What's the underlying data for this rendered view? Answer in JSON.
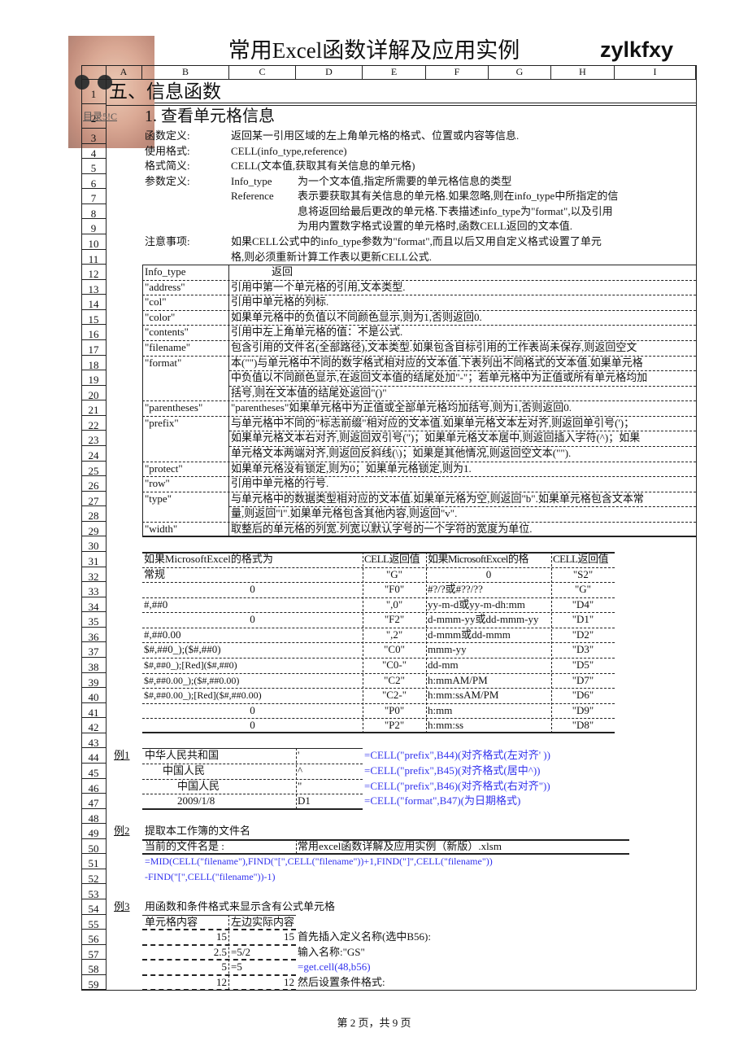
{
  "header": {
    "title": "常用Excel函数详解及应用实例",
    "author": "zylkfxy"
  },
  "columns": [
    "A",
    "B",
    "C",
    "D",
    "E",
    "F",
    "G",
    "H",
    "I"
  ],
  "row_numbers": [
    1,
    2,
    3,
    4,
    5,
    6,
    7,
    8,
    9,
    10,
    11,
    12,
    13,
    14,
    15,
    16,
    17,
    18,
    19,
    20,
    21,
    22,
    23,
    24,
    25,
    26,
    27,
    28,
    29,
    30,
    31,
    32,
    33,
    34,
    35,
    36,
    37,
    38,
    39,
    40,
    41,
    42,
    43,
    44,
    45,
    46,
    47,
    48,
    49,
    50,
    51,
    52,
    53,
    54,
    55,
    56,
    57,
    58,
    59
  ],
  "section": {
    "heading": "五、信息函数",
    "link": "目录5!C",
    "subheading": "1.  查看单元格信息"
  },
  "definition": {
    "def_label": "函数定义:",
    "def_text": "返回某一引用区域的左上角单元格的格式、位置或内容等信息.",
    "usage_label": "使用格式:",
    "usage_text": "CELL(info_type,reference)",
    "brief_label": "格式简义:",
    "brief_text": "CELL(文本值,获取其有关信息的单元格)",
    "param_label": "参数定义:",
    "param1_name": "Info_type",
    "param1_text": "为一个文本值,指定所需要的单元格信息的类型",
    "param2_name": "Reference",
    "param2_lines": [
      "表示要获取其有关信息的单元格.如果忽略,则在info_type中所指定的信",
      "息将返回给最后更改的单元格.下表描述info_type为\"format\",以及引用",
      "为用内置数字格式设置的单元格时,函数CELL返回的文本值."
    ],
    "note_label": "注意事项:",
    "note_lines": [
      "如果CELL公式中的info_type参数为\"format\",而且以后又用自定义格式设置了单元",
      "格,则必须重新计算工作表以更新CELL公式."
    ]
  },
  "info_table": {
    "header": [
      "Info_type",
      "返回"
    ],
    "rows": [
      {
        "type": "\"address\"",
        "lines": [
          "引用中第一个单元格的引用,文本类型."
        ]
      },
      {
        "type": "\"col\"",
        "lines": [
          "引用中单元格的列标."
        ]
      },
      {
        "type": "\"color\"",
        "lines": [
          "如果单元格中的负值以不同颜色显示,则为1,否则返回0."
        ]
      },
      {
        "type": "\"contents\"",
        "lines": [
          "引用中左上角单元格的值：不是公式."
        ]
      },
      {
        "type": "\"filename\"",
        "lines": [
          "包含引用的文件名(全部路径),文本类型.如果包含目标引用的工作表尚未保存,则返回空文"
        ]
      },
      {
        "type": "\"format\"",
        "lines": [
          "本(\"\")与单元格中不同的数字格式相对应的文本值.下表列出不同格式的文本值.如果单元格",
          "中负值以不同颜色显示,在返回文本值的结尾处加\"-\"；若单元格中为正值或所有单元格均加",
          "括号,则在文本值的结尾处返回\"()\""
        ]
      },
      {
        "type": "\"parentheses\"",
        "lines": [
          "\"parentheses\"如果单元格中为正值或全部单元格均加括号,则为1,否则返回0."
        ]
      },
      {
        "type": "\"prefix\"",
        "lines": [
          "与单元格中不同的\"标志前缀\"相对应的文本值.如果单元格文本左对齐,则返回单引号(')；",
          "如果单元格文本右对齐,则返回双引号(\")；如果单元格文本居中,则返回插入字符(^)；如果",
          "单元格文本两端对齐,则返回反斜线(\\)；如果是其他情况,则返回空文本(\"\")."
        ]
      },
      {
        "type": "\"protect\"",
        "lines": [
          "如果单元格没有锁定,则为0；如果单元格锁定,则为1."
        ]
      },
      {
        "type": "\"row\"",
        "lines": [
          "引用中单元格的行号."
        ]
      },
      {
        "type": "\"type\"",
        "lines": [
          "与单元格中的数据类型相对应的文本值.如果单元格为空,则返回\"b\".如果单元格包含文本常",
          "量,则返回\"l\".如果单元格包含其他内容,则返回\"v\"."
        ]
      },
      {
        "type": "\"width\"",
        "lines": [
          "取整后的单元格的列宽.列宽以默认字号的一个字符的宽度为单位."
        ]
      }
    ]
  },
  "format_table": {
    "header": [
      "如果MicrosoftExcel的格式为",
      "CELL返回值",
      "如果MicrosoftExcel的格",
      "CELL返回值"
    ],
    "rows": [
      [
        "常规",
        "\"G\"",
        "0",
        "\"S2\""
      ],
      [
        "0",
        "\"F0\"",
        "#?/?或#??/??",
        "\"G\""
      ],
      [
        "#,##0",
        "\",0\"",
        "yy-m-d或yy-m-dh:mm",
        "\"D4\""
      ],
      [
        "0",
        "\"F2\"",
        "d-mmm-yy或dd-mmm-yy",
        "\"D1\""
      ],
      [
        "#,##0.00",
        "\",2\"",
        "d-mmm或dd-mmm",
        "\"D2\""
      ],
      [
        "$#,##0_);($#,##0)",
        "\"C0\"",
        "mmm-yy",
        "\"D3\""
      ],
      [
        "$#,##0_);[Red]($#,##0)",
        "\"C0-\"",
        "dd-mm",
        "\"D5\""
      ],
      [
        "$#,##0.00_);($#,##0.00)",
        "\"C2\"",
        "h:mmAM/PM",
        "\"D7\""
      ],
      [
        "$#,##0.00_);[Red]($#,##0.00)",
        "\"C2-\"",
        "h:mm:ssAM/PM",
        "\"D6\""
      ],
      [
        "0",
        "\"P0\"",
        "h:mm",
        "\"D9\""
      ],
      [
        "0",
        "\"P2\"",
        "h:mm:ss",
        "\"D8\""
      ]
    ]
  },
  "example1": {
    "label": "例1",
    "rows": [
      {
        "text": "中华人民共和国",
        "prefix": "'",
        "formula": "=CELL(\"prefix\",B44)(对齐格式(左对齐' ))"
      },
      {
        "text": "中国人民",
        "prefix": "^",
        "formula": "=CELL(\"prefix\",B45)(对齐格式(居中^))"
      },
      {
        "text": "中国人民",
        "prefix": "\"",
        "formula": "=CELL(\"prefix\",B46)(对齐格式(右对齐\"))"
      },
      {
        "text": "2009/1/8",
        "prefix": "D1",
        "formula": "=CELL(\"format\",B47)(为日期格式)"
      }
    ]
  },
  "example2": {
    "label": "例2",
    "title": "提取本工作簿的文件名",
    "current_label": "当前的文件名是 :",
    "current_value": "常用excel函数详解及应用实例（新版）.xlsm",
    "formula_lines": [
      "=MID(CELL(\"filename\"),FIND(\"[\",CELL(\"filename\"))+1,FIND(\"]\",CELL(\"filename\"))",
      "-FIND(\"[\",CELL(\"filename\"))-1)"
    ]
  },
  "example3": {
    "label": "例3",
    "title": "用函数和条件格式来显示含有公式单元格",
    "headers": [
      "单元格内容",
      "左边实际内容"
    ],
    "rows": [
      {
        "value": "15",
        "actual": "15",
        "note": "首先插入定义名称(选中B56):",
        "note_is_formula": false
      },
      {
        "value": "2.5",
        "actual": "=5/2",
        "note": "输入名称:\"GS\"",
        "note_is_formula": false
      },
      {
        "value": "5",
        "actual": "=5",
        "note": "=get.cell(48,b56)",
        "note_is_formula": true
      },
      {
        "value": "12",
        "actual": "12",
        "note": "然后设置条件格式:",
        "note_is_formula": false
      }
    ]
  },
  "footer": {
    "page": "第 2 页，共 9 页"
  },
  "colors": {
    "formula": "#3333ee",
    "grid": "#222222"
  }
}
